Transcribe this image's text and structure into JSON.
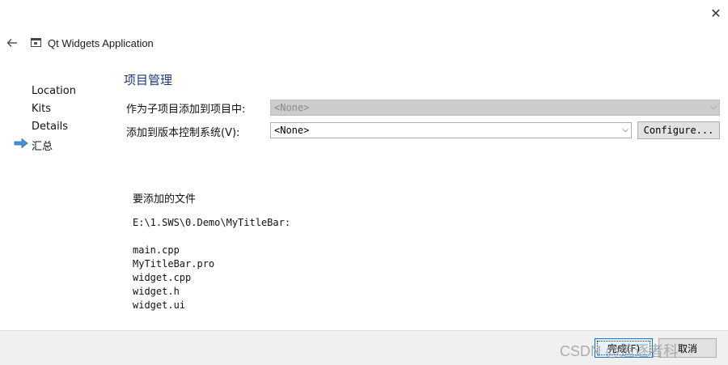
{
  "window": {
    "title": "Qt Widgets Application",
    "close_icon": "close-icon",
    "back_icon": "back-arrow-icon"
  },
  "nav": {
    "items": [
      {
        "label": "Location"
      },
      {
        "label": "Kits"
      },
      {
        "label": "Details"
      },
      {
        "label": "汇总",
        "current": true
      }
    ],
    "current_indicator_icon": "arrow-right-icon",
    "accent_color": "#4a90d9"
  },
  "page": {
    "heading": "项目管理",
    "add_as_subproject_label": "作为子项目添加到项目中:",
    "add_as_subproject_value": "<None>",
    "vcs_label": "添加到版本控制系统(V):",
    "vcs_value": "<None>",
    "configure_button": "Configure...",
    "files_heading": "要添加的文件",
    "files_path": "E:\\1.SWS\\0.Demo\\MyTitleBar:",
    "files": [
      "main.cpp",
      "MyTitleBar.pro",
      "widget.cpp",
      "widget.h",
      "widget.ui"
    ]
  },
  "footer": {
    "finish_button": "完成(F)",
    "cancel_button": "取消",
    "watermark": "CSDN @追逐者科"
  }
}
